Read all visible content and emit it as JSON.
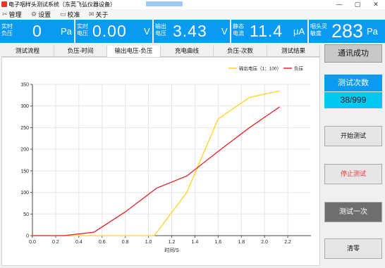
{
  "window": {
    "title": "电子咽样头测试系统（东莞飞弘仪器设备）",
    "minimize": "—",
    "maximize": "▢",
    "close": "✕"
  },
  "menu": [
    {
      "label": "管理",
      "icon": "wrench-icon"
    },
    {
      "label": "设置",
      "icon": "gear-icon"
    },
    {
      "label": "校准",
      "icon": "calibrate-icon"
    },
    {
      "label": "关于",
      "icon": "info-icon"
    }
  ],
  "panels": {
    "pressure": {
      "label": "实时负压",
      "value": "0",
      "unit": "Pa"
    },
    "voltage": {
      "label": "实时电压",
      "value": "0.00",
      "unit": "V"
    },
    "output_voltage": {
      "label": "输出电压",
      "value": "3.43",
      "unit": "V"
    },
    "static_current": {
      "label": "静态电流",
      "value": "11.4",
      "unit": "μA"
    },
    "sensitivity": {
      "label": "咽头灵敏度",
      "value": "283",
      "unit": "Pa"
    }
  },
  "tabs": [
    "测试流程",
    "负压-时间",
    "输出电压-负压",
    "充电曲线",
    "负压-次数",
    "测试结果"
  ],
  "active_tab": 2,
  "right": {
    "status": "通讯成功",
    "count_label": "测试次数",
    "count_value": "38/999",
    "start_button": "开始测试",
    "stop_button": "停止测试",
    "once_button": "测试一次",
    "zero_button": "清零"
  },
  "chart_data": {
    "type": "line",
    "xlabel": "时间/S",
    "ylabel": "",
    "xlim": [
      0,
      2.4
    ],
    "ylim": [
      0,
      350
    ],
    "xticks": [
      0.0,
      0.2,
      0.4,
      0.6,
      0.8,
      1.0,
      1.2,
      1.4,
      1.6,
      1.8,
      2.0,
      2.2
    ],
    "yticks": [
      0,
      50,
      100,
      150,
      200,
      250,
      300,
      350
    ],
    "grid": true,
    "legend_position": "top-right",
    "series": [
      {
        "name": "输出电压（1：100）",
        "color": "#ffd21f",
        "points": [
          [
            0.0,
            0
          ],
          [
            0.3,
            0
          ],
          [
            0.6,
            0
          ],
          [
            1.05,
            0
          ],
          [
            1.33,
            100
          ],
          [
            1.6,
            270
          ],
          [
            1.87,
            320
          ],
          [
            2.13,
            335
          ]
        ]
      },
      {
        "name": "负压",
        "color": "#e8202a",
        "points": [
          [
            0.0,
            0
          ],
          [
            0.27,
            0
          ],
          [
            0.53,
            8
          ],
          [
            0.8,
            55
          ],
          [
            1.07,
            110
          ],
          [
            1.33,
            138
          ],
          [
            1.6,
            195
          ],
          [
            1.87,
            250
          ],
          [
            2.13,
            298
          ]
        ]
      }
    ]
  }
}
